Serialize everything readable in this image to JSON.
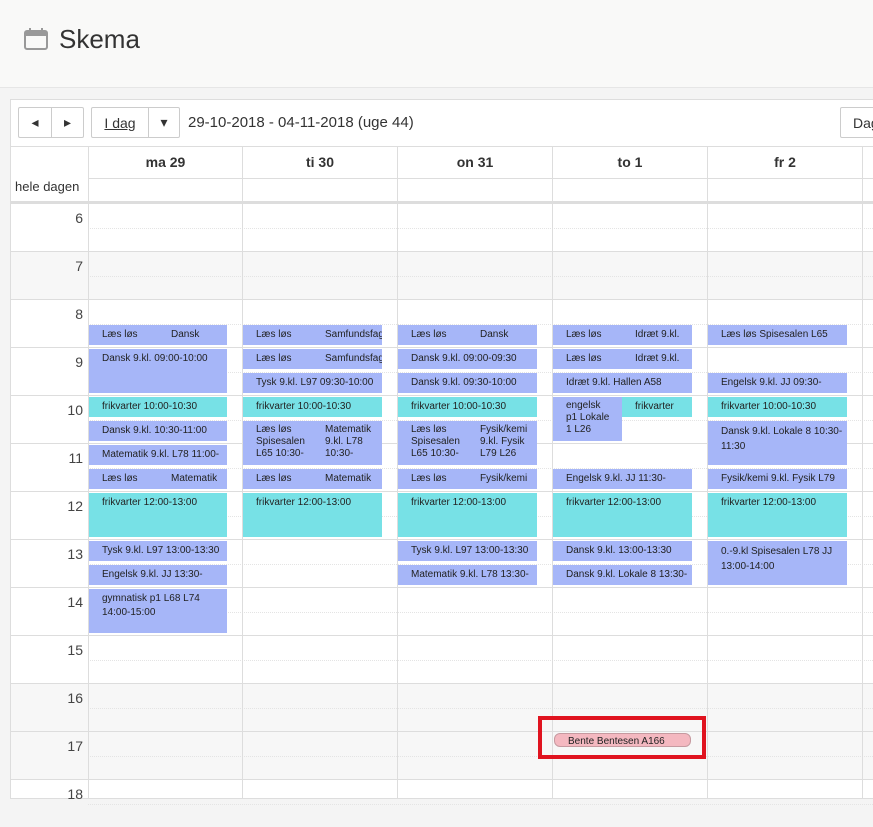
{
  "header": {
    "title": "Skema",
    "icon": "calendar-icon"
  },
  "toolbar": {
    "prev": "◂",
    "next": "▸",
    "today": "I dag",
    "dropdown": "▾",
    "range": "29-10-2018 - 04-11-2018 (uge 44)",
    "view": "Dag"
  },
  "days": [
    "ma 29",
    "ti 30",
    "on 31",
    "to 1",
    "fr 2"
  ],
  "allday_label": "hele dagen",
  "hours": [
    "6",
    "7",
    "8",
    "9",
    "10",
    "11",
    "12",
    "13",
    "14",
    "15",
    "16",
    "17",
    "18"
  ],
  "events": {
    "mo": {
      "e1a": "Læs løs",
      "e1b": "Dansk",
      "e2": "Dansk 9.kl. 09:00-10:00",
      "e3": "frikvarter 10:00-10:30",
      "e4": "Dansk 9.kl. 10:30-11:00",
      "e5": "Matematik 9.kl. L78 11:00-",
      "e6a": "Læs løs",
      "e6b": "Matematik",
      "e7": "frikvarter 12:00-13:00",
      "e8": "Tysk 9.kl. L97 13:00-13:30",
      "e9": "Engelsk 9.kl. JJ 13:30-",
      "e10a": "gymnatisk p1 L68 L74",
      "e10b": "14:00-15:00"
    },
    "tu": {
      "e1a": "Læs løs",
      "e1b": "Samfundsfag",
      "e2a": "Læs løs",
      "e2b": "Samfundsfag",
      "e3": "Tysk 9.kl. L97 09:30-10:00",
      "e4": "frikvarter 10:00-10:30",
      "e5a": "Læs løs",
      "e5b": "Spisesalen",
      "e5c": "L65 10:30-",
      "e5d": "Matematik",
      "e5e": "9.kl. L78",
      "e5f": "10:30-",
      "e6a": "Læs løs",
      "e6b": "Matematik",
      "e7": "frikvarter 12:00-13:00"
    },
    "we": {
      "e1a": "Læs løs",
      "e1b": "Dansk",
      "e2": "Dansk 9.kl. 09:00-09:30",
      "e3": "Dansk 9.kl. 09:30-10:00",
      "e4": "frikvarter 10:00-10:30",
      "e5a": "Læs løs",
      "e5b": "Spisesalen",
      "e5c": "L65 10:30-",
      "e5d": "Fysik/kemi",
      "e5e": "9.kl. Fysik",
      "e5f": "L79 L26",
      "e6a": "Læs løs",
      "e6b": "Fysik/kemi",
      "e7": "frikvarter 12:00-13:00",
      "e8": "Tysk 9.kl. L97 13:00-13:30",
      "e9": "Matematik 9.kl. L78 13:30-"
    },
    "th": {
      "e1a": "Læs løs",
      "e1b": "Idræt 9.kl.",
      "e2a": "Læs løs",
      "e2b": "Idræt 9.kl.",
      "e3": "Idræt 9.kl. Hallen A58",
      "e4a": "engelsk",
      "e4b": "p1 Lokale",
      "e4c": "1 L26",
      "e4d": "frikvarter",
      "e5": "Engelsk 9.kl. JJ 11:30-",
      "e6": "frikvarter 12:00-13:00",
      "e7": "Dansk 9.kl. 13:00-13:30",
      "e8": "Dansk 9.kl. Lokale 8 13:30-",
      "e9": "Bente Bentesen A166"
    },
    "fr": {
      "e1": "Læs løs Spisesalen L65",
      "e2": "Engelsk 9.kl. JJ 09:30-",
      "e3": "frikvarter 10:00-10:30",
      "e4a": "Dansk 9.kl. Lokale 8 10:30-",
      "e4b": "11:30",
      "e5": "Fysik/kemi 9.kl. Fysik L79",
      "e6": "frikvarter 12:00-13:00",
      "e7a": "0.-9.kl Spisesalen L78 JJ",
      "e7b": "13:00-14:00"
    }
  },
  "colors": {
    "lesson": "#a6b6f8",
    "break": "#77e1e6",
    "meeting": "#f4b8c0",
    "highlight": "#e0131f"
  }
}
